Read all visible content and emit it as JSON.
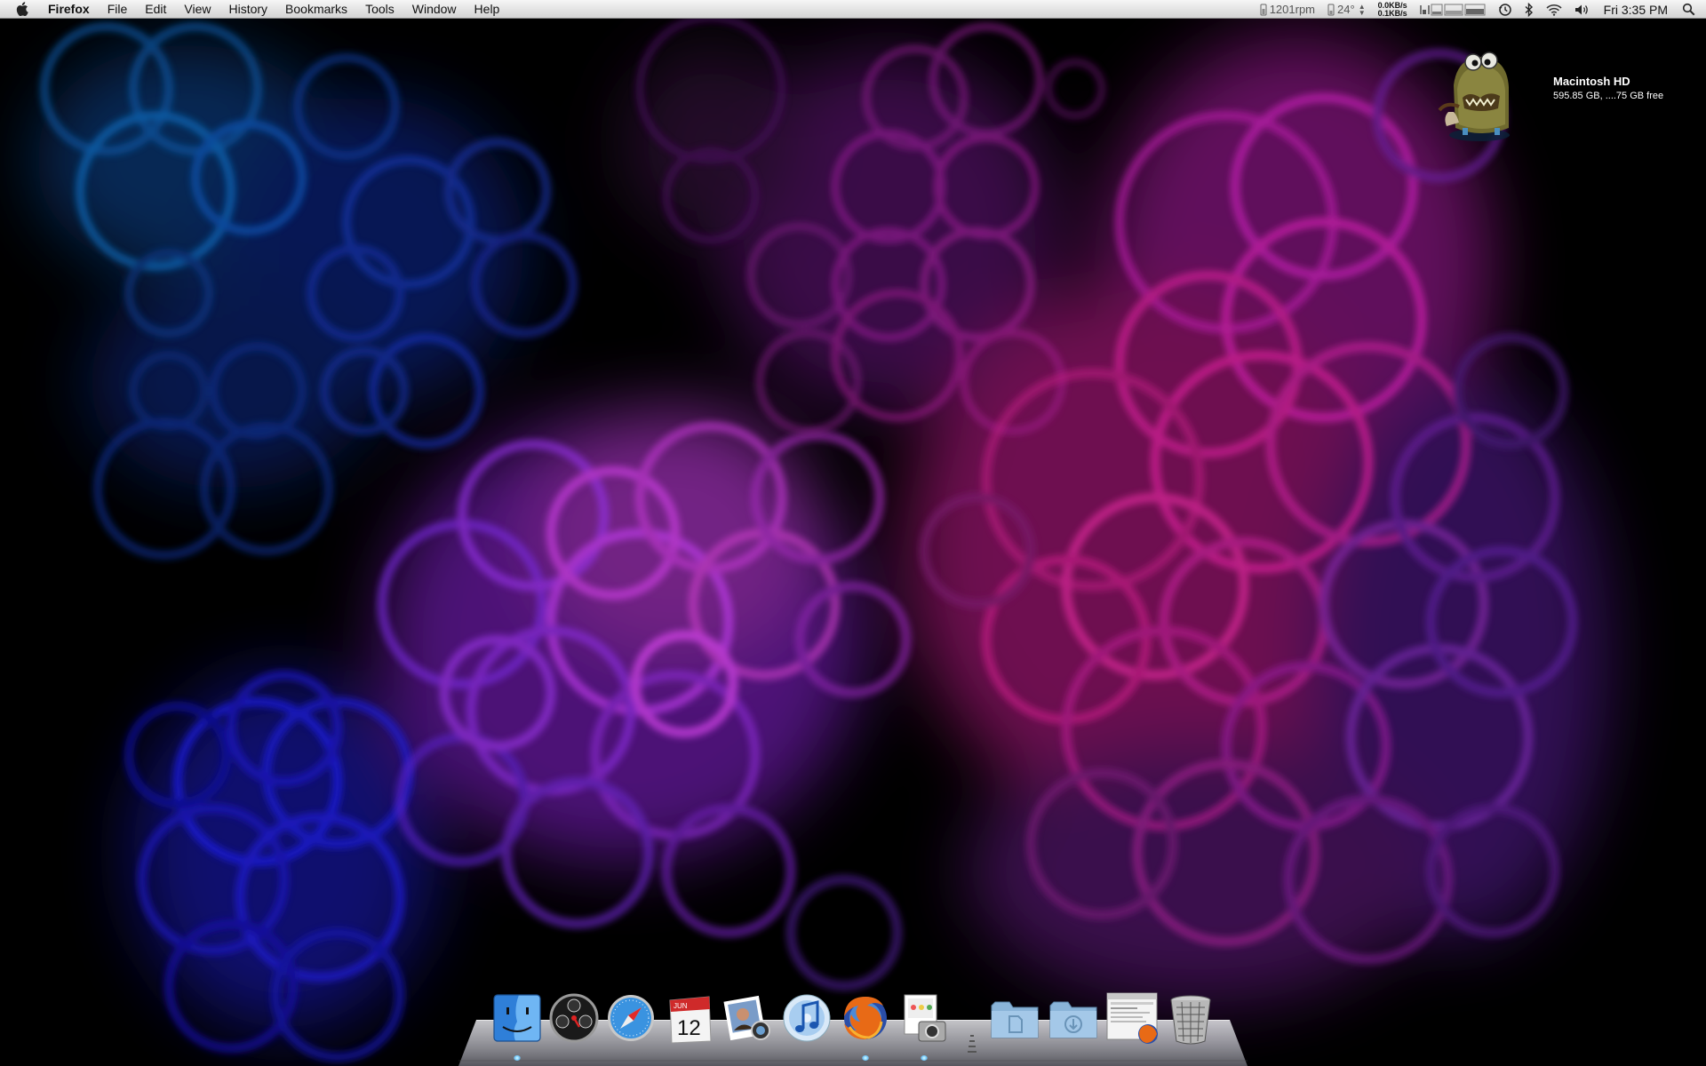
{
  "menubar": {
    "app_name": "Firefox",
    "items": [
      "File",
      "Edit",
      "View",
      "History",
      "Bookmarks",
      "Tools",
      "Window",
      "Help"
    ],
    "status": {
      "fan_speed": "1201rpm",
      "temperature": "24°",
      "net_down": "0.0KB/s",
      "net_up": "0.1KB/s",
      "clock": "Fri 3:35 PM"
    }
  },
  "desktop": {
    "hd_name": "Macintosh HD",
    "hd_info": "595.85 GB, ....75 GB free"
  },
  "dock": {
    "calendar_month": "JUN",
    "calendar_day": "12",
    "apps": [
      "finder-icon",
      "dashboard-icon",
      "safari-icon",
      "ical-icon",
      "iphoto-icon",
      "itunes-icon",
      "firefox-icon",
      "preview-icon",
      "documents-folder-icon",
      "downloads-folder-icon",
      "firefox-window-icon",
      "trash-icon"
    ]
  },
  "colors": {
    "menubar": "#e3e3e3",
    "wallpaper_blue": "#1a4bff",
    "wallpaper_magenta": "#ff2fd0",
    "wallpaper_purple": "#9a3cff"
  }
}
